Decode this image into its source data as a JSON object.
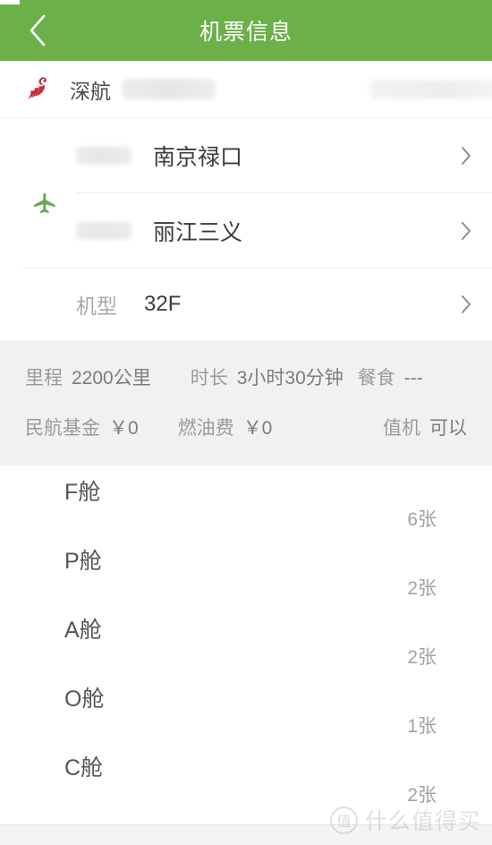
{
  "header": {
    "title": "机票信息",
    "back_icon": "chevron-left-icon",
    "background_color": "#6bb048",
    "title_color": "#ffffff"
  },
  "airline": {
    "logo_icon": "shenzhen-airlines-bird-logo",
    "logo_color": "#c8293c",
    "name": "深航",
    "flight_number_redacted": "",
    "right_field_redacted": ""
  },
  "route": {
    "plane_icon": "airplane-icon",
    "plane_icon_color": "#6aa84f",
    "chevron_icon": "chevron-right-icon",
    "segments": [
      {
        "time_redacted": "",
        "airport": "南京禄口"
      },
      {
        "time_redacted": "",
        "airport": "丽江三义"
      }
    ]
  },
  "aircraft": {
    "label": "机型",
    "value": "32F",
    "chevron_icon": "chevron-right-icon"
  },
  "info_panel": {
    "background_color": "#f1f1f1",
    "row1": [
      {
        "key": "里程",
        "value": "2200公里"
      },
      {
        "key": "时长",
        "value": "3小时30分钟"
      },
      {
        "key": "餐食",
        "value": "---"
      }
    ],
    "row2": [
      {
        "key": "民航基金",
        "value": "￥0"
      },
      {
        "key": "燃油费",
        "value": "￥0"
      },
      {
        "key": "值机",
        "value": "可以"
      }
    ]
  },
  "cabins": [
    {
      "label": "F舱",
      "count": "6张"
    },
    {
      "label": "P舱",
      "count": "2张"
    },
    {
      "label": "A舱",
      "count": "2张"
    },
    {
      "label": "O舱",
      "count": "1张"
    },
    {
      "label": "C舱",
      "count": "2张"
    }
  ],
  "watermark": {
    "mark": "值",
    "text": "什么值得买"
  }
}
